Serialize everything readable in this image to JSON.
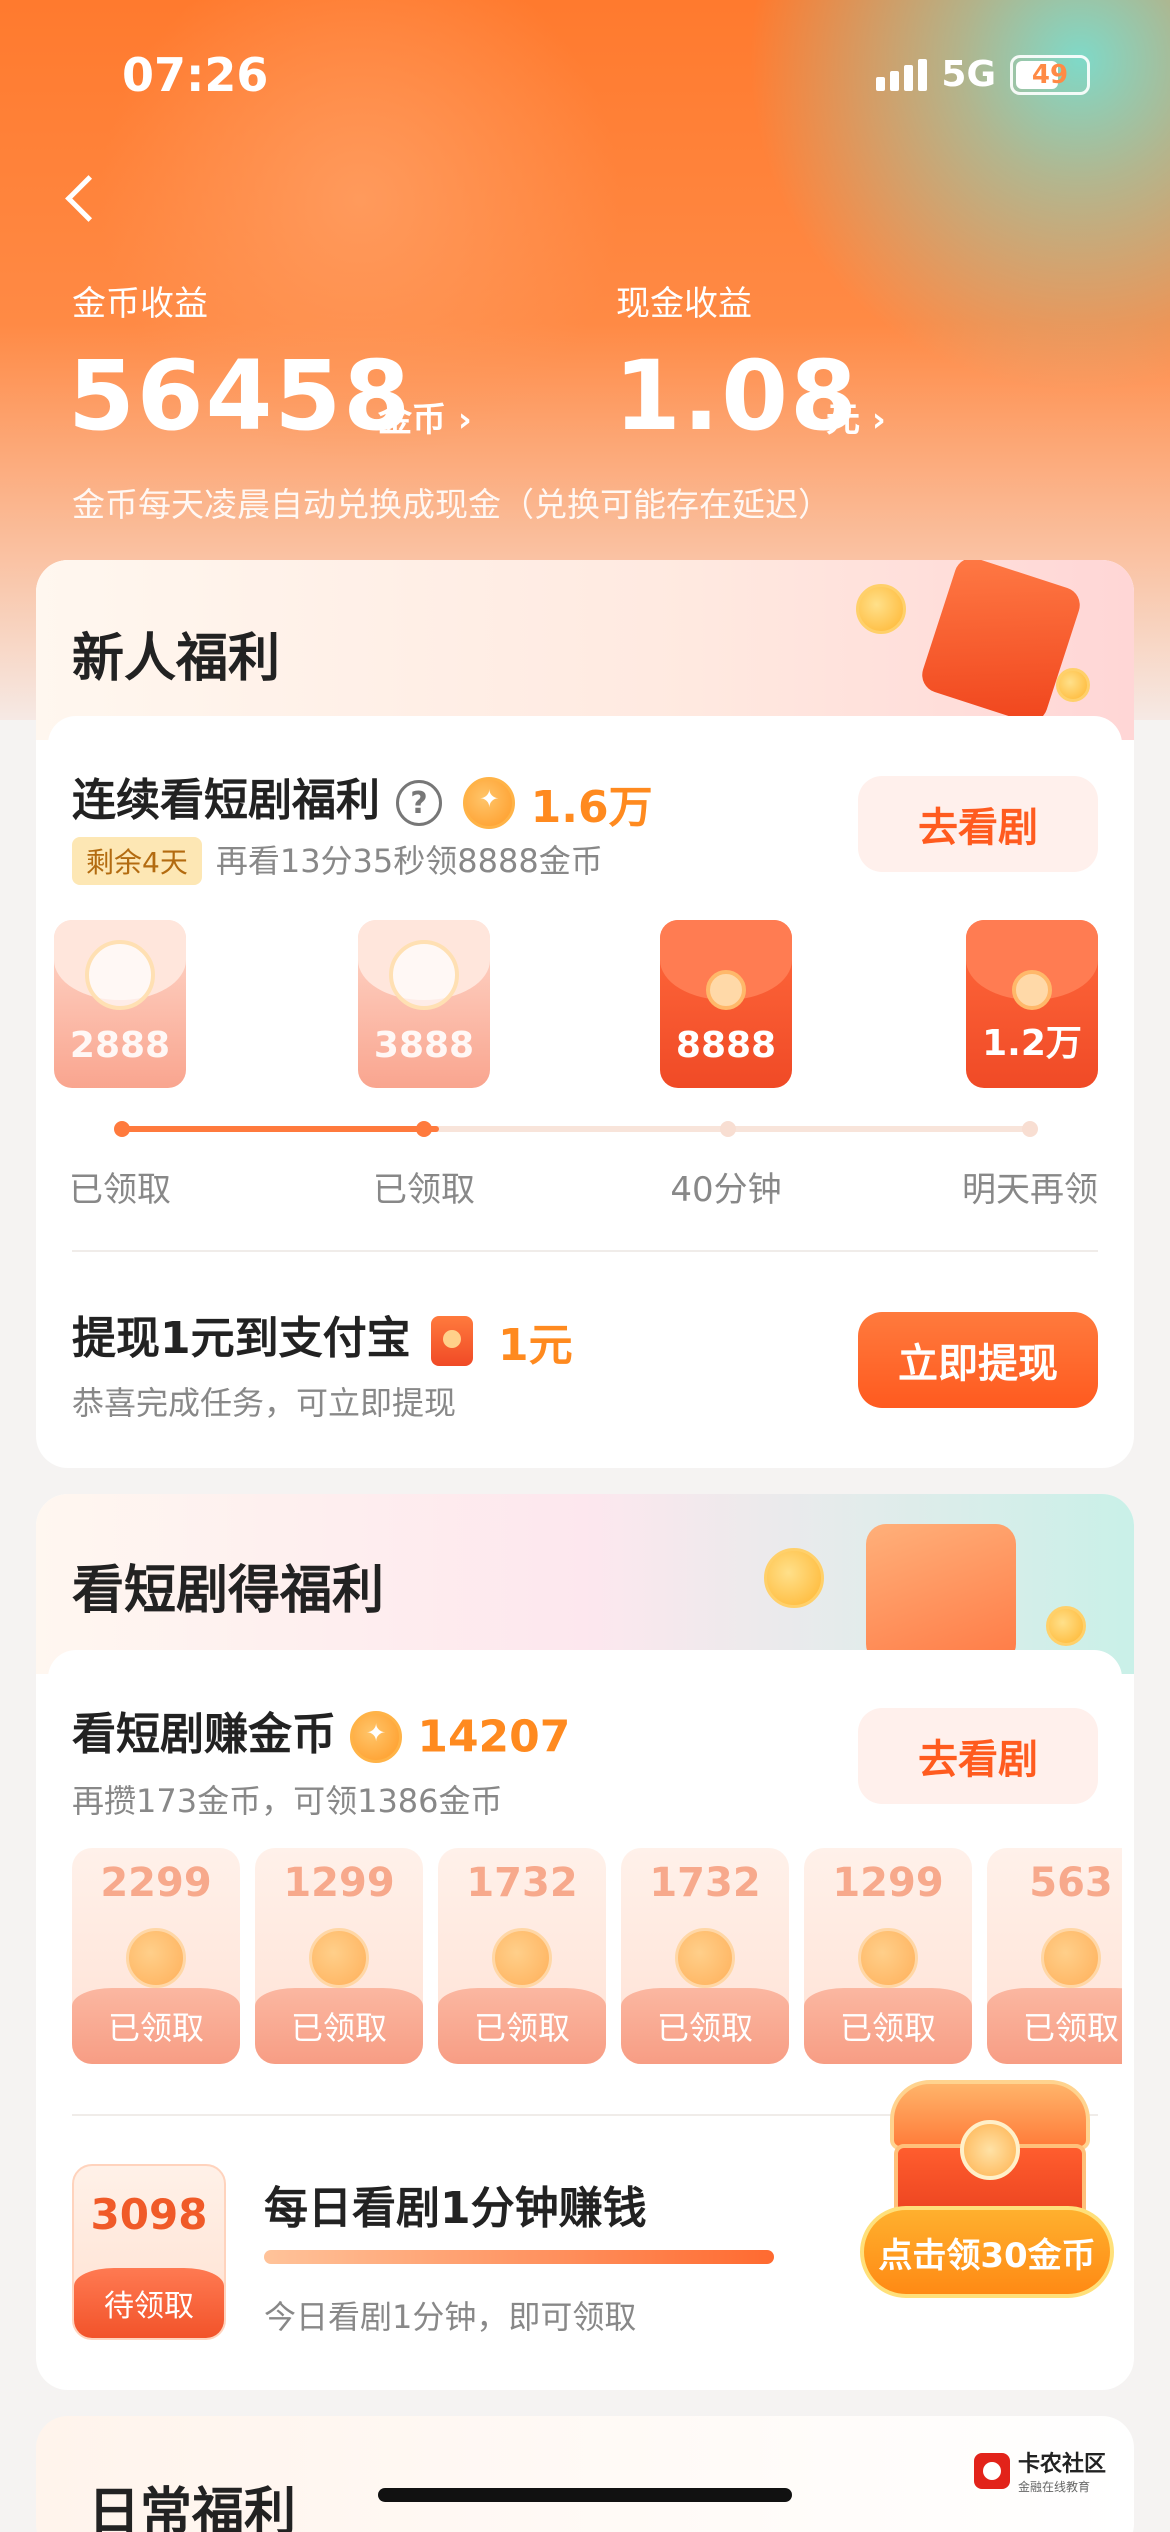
{
  "status": {
    "time": "07:26",
    "network": "5G",
    "battery": "49"
  },
  "earnings": {
    "coins_label": "金币收益",
    "coins_value": "56458",
    "coins_unit": "金币 ›",
    "cash_label": "现金收益",
    "cash_value": "1.08",
    "cash_unit": "元 ›",
    "note": "金币每天凌晨自动兑换成现金（兑换可能存在延迟）"
  },
  "newcomer": {
    "title": "新人福利",
    "streak": {
      "title": "连续看短剧福利",
      "help": "?",
      "coins": "1.6万",
      "days_badge": "剩余4天",
      "subtitle": "再看13分35秒领8888金币",
      "button": "去看剧",
      "rewards": [
        {
          "amount": "2888",
          "label": "已领取",
          "state": "claimed"
        },
        {
          "amount": "3888",
          "label": "已领取",
          "state": "claimed"
        },
        {
          "amount": "8888",
          "label": "40分钟",
          "state": "active"
        },
        {
          "amount": "1.2万",
          "label": "明天再领",
          "state": "active"
        }
      ],
      "progress_fraction": 0.35
    },
    "withdraw": {
      "title": "提现1元到支付宝",
      "amount": "1元",
      "subtitle": "恭喜完成任务，可立即提现",
      "button": "立即提现"
    }
  },
  "drama": {
    "title": "看短剧得福利",
    "earn": {
      "title": "看短剧赚金币",
      "coins": "14207",
      "subtitle": "再攒173金币，可领1386金币",
      "button": "去看剧",
      "tiles": [
        {
          "amount": "2299",
          "label": "已领取"
        },
        {
          "amount": "1299",
          "label": "已领取"
        },
        {
          "amount": "1732",
          "label": "已领取"
        },
        {
          "amount": "1732",
          "label": "已领取"
        },
        {
          "amount": "1299",
          "label": "已领取"
        },
        {
          "amount": "563",
          "label": "已领取"
        }
      ]
    },
    "daily": {
      "pending_amount": "3098",
      "pending_label": "待领取",
      "title": "每日看剧1分钟赚钱",
      "subtitle": "今日看剧1分钟，即可领取",
      "chest_button": "点击领30金币"
    }
  },
  "daily_section": {
    "title": "日常福利"
  },
  "watermark": {
    "name": "卡农社区",
    "tagline": "金融在线教育"
  }
}
